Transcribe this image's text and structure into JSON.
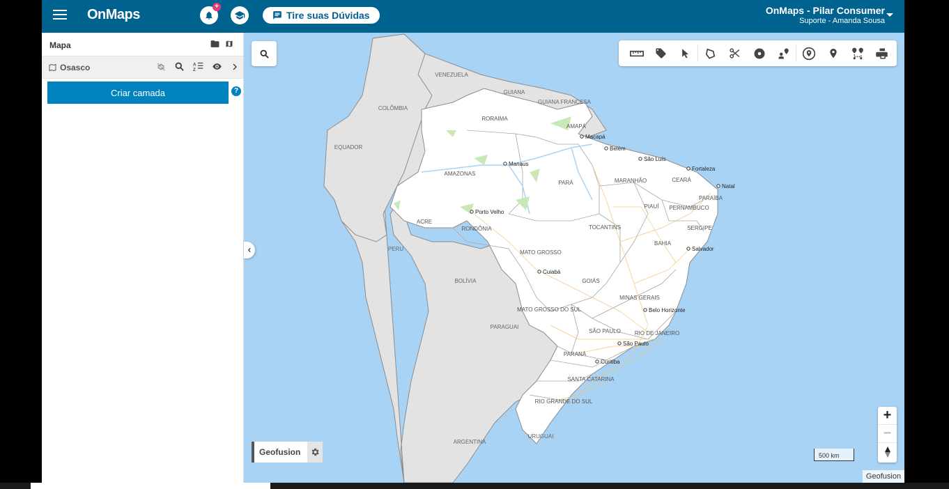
{
  "header": {
    "brand": "OnMaps",
    "notification_badge": "+",
    "help_button": "Tire suas Dúvidas",
    "account_name": "OnMaps - Pilar Consumer",
    "account_sub": "Suporte - Amanda Sousa"
  },
  "panel": {
    "title": "Mapa",
    "project": "Osasco",
    "create_layer": "Criar camada",
    "help_mark": "?"
  },
  "map": {
    "layer_name": "Geofusion",
    "scale_label": "500 km",
    "attribution": "Geofusion",
    "zoom_in": "+",
    "zoom_out": "−",
    "countries": [
      "VENEZUELA",
      "GUIANA",
      "GUIANA FRANCESA",
      "COLÔMBIA",
      "EQUADOR",
      "PERU",
      "BOLÍVIA",
      "PARAGUAI",
      "ARGENTINA",
      "URUGUAI"
    ],
    "states": [
      "RORAIMA",
      "AMAPÁ",
      "AMAZONAS",
      "PARÁ",
      "MARANHÃO",
      "CEARÁ",
      "PARAÍBA",
      "PIAUÍ",
      "PERNAMBUCO",
      "ACRE",
      "RONDÔNIA",
      "TOCANTINS",
      "SERGIPE",
      "BAHIA",
      "MATO GROSSO",
      "GOIÁS",
      "MINAS GERAIS",
      "MATO GROSSO DO SUL",
      "SÃO PAULO",
      "RIO DE JANEIRO",
      "PARANÁ",
      "SANTA CATARINA",
      "RIO GRANDE DO SUL"
    ],
    "cities": [
      "Macapá",
      "Belém",
      "São Luís",
      "Fortaleza",
      "Natal",
      "Manaus",
      "Porto Velho",
      "Salvador",
      "Cuiabá",
      "Belo Horizonte",
      "São Paulo",
      "Curitiba"
    ]
  },
  "colors": {
    "header": "#00628f",
    "primary_button": "#0082bf",
    "notification": "#e23b7b",
    "ocean": "#a9d3f5",
    "brazil": "#ffffff",
    "other_land": "#e3e3e3"
  },
  "icons": [
    "menu-icon",
    "bell-icon",
    "graduation-cap-icon",
    "chat-icon",
    "folder-icon",
    "map-icon",
    "layers-off-icon",
    "search-icon",
    "sort-az-icon",
    "eye-icon",
    "chevron-right-icon",
    "ruler-icon",
    "tag-icon",
    "pointer-icon",
    "polygon-icon",
    "scissors-icon",
    "radius-icon",
    "person-pin-icon",
    "pin-circle-icon",
    "pin-icon",
    "route-icon",
    "printer-icon",
    "gear-icon",
    "compass-icon",
    "chevron-left-icon"
  ]
}
